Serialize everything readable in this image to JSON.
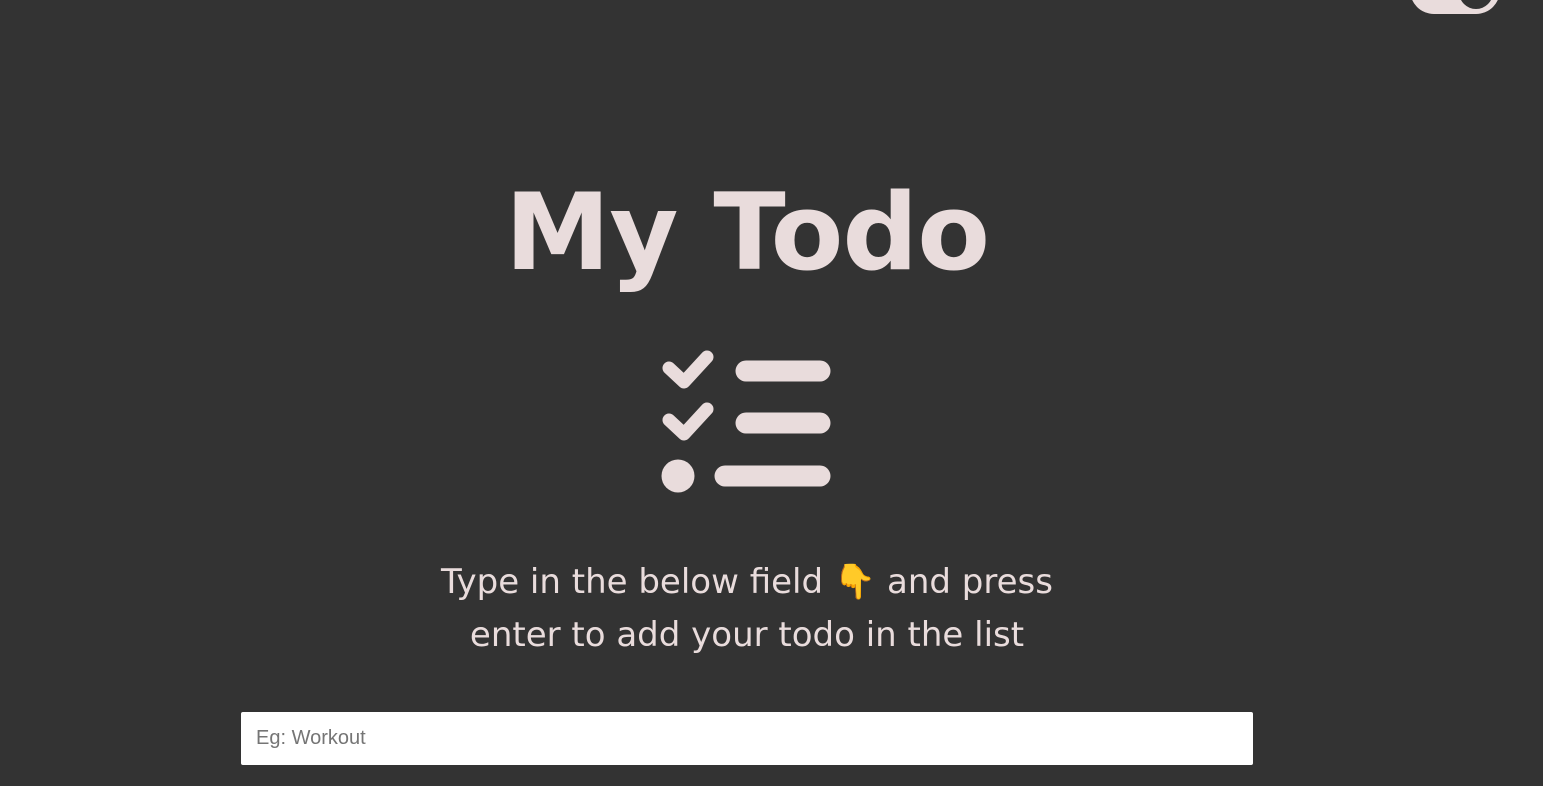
{
  "header": {
    "title": "My Todo"
  },
  "theme_toggle": {
    "icon": "toggle-switch-icon"
  },
  "logo": {
    "icon": "checklist-icon",
    "color": "#e9dcdc"
  },
  "instruction": {
    "line1": "Type in the below field 👇 and press",
    "line2": "enter to add your todo in the list"
  },
  "todo_input": {
    "placeholder": "Eg: Workout",
    "value": ""
  },
  "colors": {
    "background": "#333333",
    "foreground": "#e9dcdc",
    "input_background": "#ffffff"
  }
}
